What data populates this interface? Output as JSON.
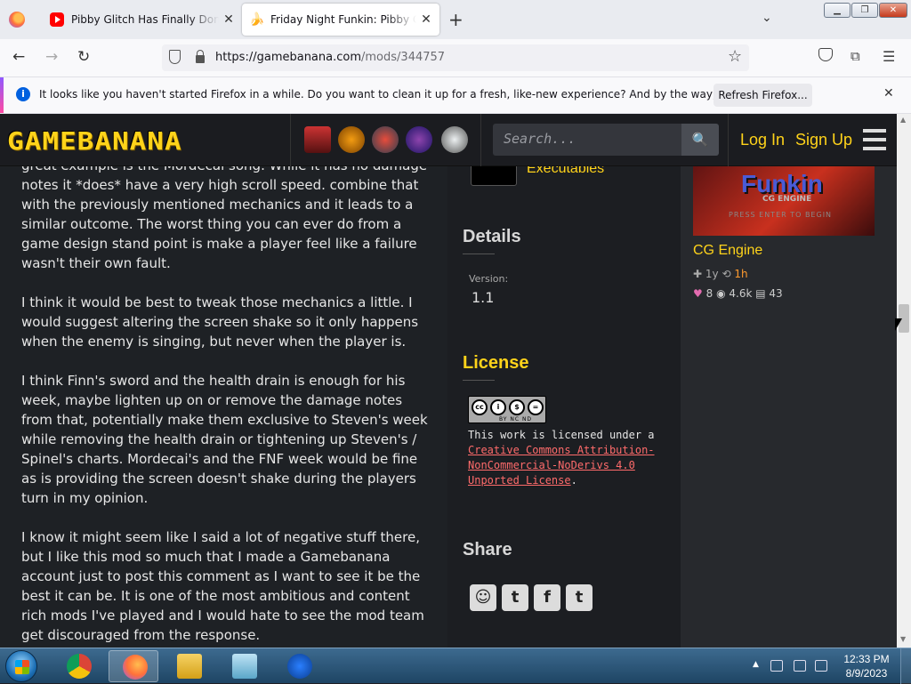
{
  "browser": {
    "tabs": [
      {
        "title": "Pibby Glitch Has Finally Done T",
        "icon": "youtube-icon"
      },
      {
        "title": "Friday Night Funkin: Pibby Corr",
        "icon": "banana-icon"
      }
    ],
    "url_host": "https://gamebanana.com",
    "url_path": "/mods/344757",
    "notification": {
      "text": "It looks like you haven't started Firefox in a while. Do you want to clean it up for a fresh, like-new experience? And by the way, welcome back!",
      "button": "Refresh Firefox..."
    }
  },
  "site": {
    "logo": "GAMEBANANA",
    "search_placeholder": "Search...",
    "login": "Log In",
    "signup": "Sign Up",
    "accent": "#ffd31a"
  },
  "comment": {
    "paragraphs": [
      "great example is the Mordecai song. While it has no damage notes it *does* have a very high scroll speed. combine that with the previously mentioned mechanics and it leads to a similar outcome. The worst thing you can ever do from a game design stand point is make a player feel like a failure wasn't their own fault.",
      "I think it would be best to tweak those mechanics a little. I would suggest altering the screen shake so it only happens when the enemy is singing, but never when the player is.",
      "I think Finn's sword and the health drain is enough for his week, maybe lighten up on or remove the damage notes from that, potentially make them exclusive to Steven's week while removing the health drain or tightening up Steven's / Spinel's charts. Mordecai's and the FNF week would be fine as is providing the screen doesn't shake during the players turn in my opinion.",
      "I know it might seem like I said a lot of negative stuff there, but I like this mod so much that I made a Gamebanana account just to post this comment as I want to see it be the best it can be. It is one of the most ambitious and content rich mods I've played and I would hate to see the mod team get discouraged from the response."
    ]
  },
  "sidebar": {
    "executables_label": "Executables",
    "details_heading": "Details",
    "version_label": "Version:",
    "version_value": "1.1",
    "license_heading": "License",
    "cc_tags": "BY NC ND",
    "license_prefix": "This work is licensed under a ",
    "license_link": "Creative Commons Attribution-NonCommercial-NoDerivs 4.0 Unported License",
    "license_suffix": ".",
    "share_heading": "Share"
  },
  "related_mod": {
    "thumb_title": "Funkin",
    "thumb_sub": "CG ENGINE",
    "thumb_press": "PRESS ENTER TO BEGIN",
    "name": "CG Engine",
    "age": "1y",
    "updated": "1h",
    "likes": "8",
    "views": "4.6k",
    "posts": "43"
  },
  "taskbar": {
    "time": "12:33 PM",
    "date": "8/9/2023"
  }
}
